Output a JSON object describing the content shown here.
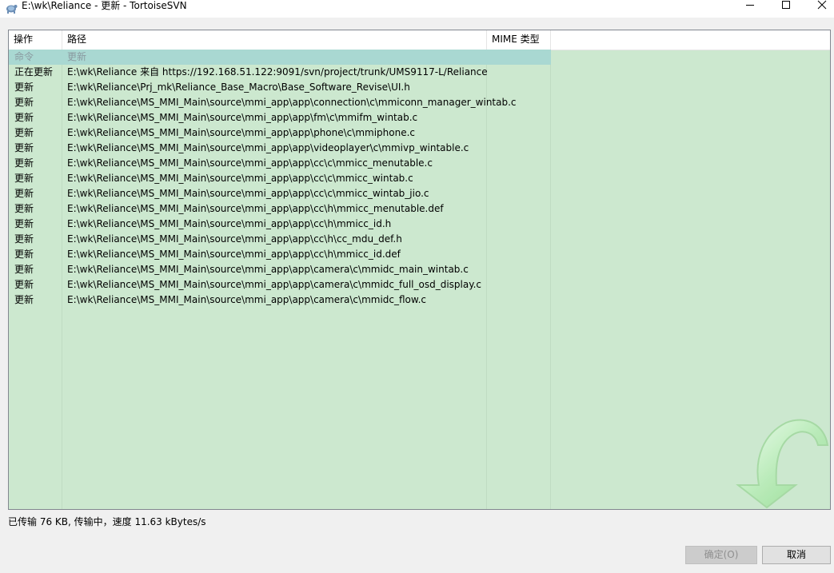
{
  "window": {
    "title": "E:\\wk\\Reliance - 更新 - TortoiseSVN",
    "app_icon": "tortoise-icon"
  },
  "list": {
    "columns": [
      "操作",
      "路径",
      "MIME 类型"
    ],
    "rows": [
      {
        "action": "命令",
        "path": "更新",
        "type": "command"
      },
      {
        "action": "正在更新",
        "path": "E:\\wk\\Reliance 来自 https://192.168.51.122:9091/svn/project/trunk/UMS9117-L/Reliance"
      },
      {
        "action": "更新",
        "path": "E:\\wk\\Reliance\\Prj_mk\\Reliance_Base_Macro\\Base_Software_Revise\\UI.h"
      },
      {
        "action": "更新",
        "path": "E:\\wk\\Reliance\\MS_MMI_Main\\source\\mmi_app\\app\\connection\\c\\mmiconn_manager_wintab.c"
      },
      {
        "action": "更新",
        "path": "E:\\wk\\Reliance\\MS_MMI_Main\\source\\mmi_app\\app\\fm\\c\\mmifm_wintab.c"
      },
      {
        "action": "更新",
        "path": "E:\\wk\\Reliance\\MS_MMI_Main\\source\\mmi_app\\app\\phone\\c\\mmiphone.c"
      },
      {
        "action": "更新",
        "path": "E:\\wk\\Reliance\\MS_MMI_Main\\source\\mmi_app\\app\\videoplayer\\c\\mmivp_wintable.c"
      },
      {
        "action": "更新",
        "path": "E:\\wk\\Reliance\\MS_MMI_Main\\source\\mmi_app\\app\\cc\\c\\mmicc_menutable.c"
      },
      {
        "action": "更新",
        "path": "E:\\wk\\Reliance\\MS_MMI_Main\\source\\mmi_app\\app\\cc\\c\\mmicc_wintab.c"
      },
      {
        "action": "更新",
        "path": "E:\\wk\\Reliance\\MS_MMI_Main\\source\\mmi_app\\app\\cc\\c\\mmicc_wintab_jio.c"
      },
      {
        "action": "更新",
        "path": "E:\\wk\\Reliance\\MS_MMI_Main\\source\\mmi_app\\app\\cc\\h\\mmicc_menutable.def"
      },
      {
        "action": "更新",
        "path": "E:\\wk\\Reliance\\MS_MMI_Main\\source\\mmi_app\\app\\cc\\h\\mmicc_id.h"
      },
      {
        "action": "更新",
        "path": "E:\\wk\\Reliance\\MS_MMI_Main\\source\\mmi_app\\app\\cc\\h\\cc_mdu_def.h"
      },
      {
        "action": "更新",
        "path": "E:\\wk\\Reliance\\MS_MMI_Main\\source\\mmi_app\\app\\cc\\h\\mmicc_id.def"
      },
      {
        "action": "更新",
        "path": "E:\\wk\\Reliance\\MS_MMI_Main\\source\\mmi_app\\app\\camera\\c\\mmidc_main_wintab.c"
      },
      {
        "action": "更新",
        "path": "E:\\wk\\Reliance\\MS_MMI_Main\\source\\mmi_app\\app\\camera\\c\\mmidc_full_osd_display.c"
      },
      {
        "action": "更新",
        "path": "E:\\wk\\Reliance\\MS_MMI_Main\\source\\mmi_app\\app\\camera\\c\\mmidc_flow.c"
      }
    ],
    "watermark_icon": "update-arrow-icon"
  },
  "status": {
    "text": "已传输 76 KB, 传输中，速度 11.63 kBytes/s"
  },
  "buttons": {
    "ok": "确定(O)",
    "cancel": "取消"
  },
  "colors": {
    "list_bg": "#cce8cf",
    "command_row_bg": "#a9d8d2",
    "title_bg": "#ffffff"
  }
}
